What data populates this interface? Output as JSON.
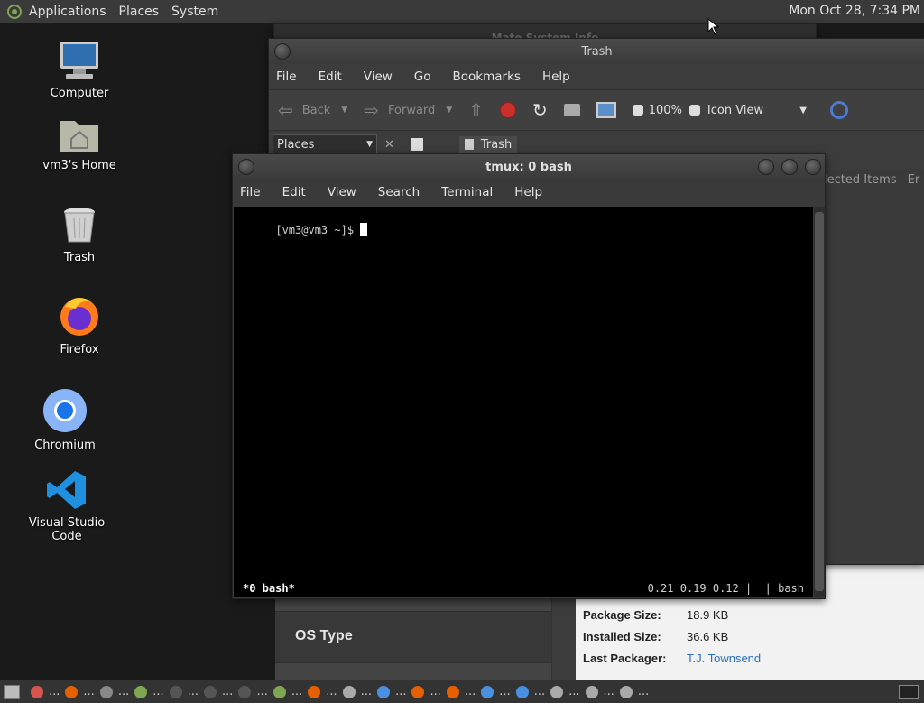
{
  "top_panel": {
    "menus": [
      "Applications",
      "Places",
      "System"
    ],
    "clock": "Mon Oct 28,  7:34 PM"
  },
  "desktop": {
    "icons": [
      {
        "label": "Computer",
        "icon": "computer-icon"
      },
      {
        "label": "vm3's Home",
        "icon": "home-folder-icon"
      },
      {
        "label": "Trash",
        "icon": "trash-icon"
      },
      {
        "label": "Firefox",
        "icon": "firefox-icon"
      },
      {
        "label": "Chromium",
        "icon": "chromium-icon"
      },
      {
        "label": "Visual Studio Code",
        "icon": "vscode-icon"
      }
    ]
  },
  "sysinfo_window": {
    "title": "Mate System Info",
    "os_type_label": "OS Type",
    "details": [
      {
        "key": "Package Size:",
        "value": "18.9 KB"
      },
      {
        "key": "Installed Size:",
        "value": "36.6 KB"
      },
      {
        "key": "Last Packager:",
        "value": "T.J. Townsend"
      }
    ]
  },
  "trash_window": {
    "title": "Trash",
    "menus": [
      "File",
      "Edit",
      "View",
      "Go",
      "Bookmarks",
      "Help"
    ],
    "toolbar": {
      "back": "Back",
      "forward": "Forward",
      "zoom": "100%",
      "view_mode": "Icon View"
    },
    "places_label": "Places",
    "location": "Trash",
    "columns_partial": "elected Items",
    "columns_partial2": "Er"
  },
  "terminal_window": {
    "title": "tmux: 0 bash",
    "menus": [
      "File",
      "Edit",
      "View",
      "Search",
      "Terminal",
      "Help"
    ],
    "prompt": "[vm3@vm3 ~]$ ",
    "status_left": "*0 bash*",
    "status_right": "0.21 0.19 0.12 |  | bash"
  },
  "taskbar": {
    "items": [
      {
        "icon": "help-icon",
        "color": "#d9534f",
        "label": "..."
      },
      {
        "icon": "firefox-icon",
        "color": "#e66000",
        "label": "..."
      },
      {
        "icon": "keyboard-icon",
        "color": "#888",
        "label": "..."
      },
      {
        "icon": "mate-icon",
        "color": "#7fa650",
        "label": "..."
      },
      {
        "icon": "app-icon",
        "color": "#555",
        "label": "..."
      },
      {
        "icon": "app-icon",
        "color": "#555",
        "label": "..."
      },
      {
        "icon": "app-icon",
        "color": "#555",
        "label": "..."
      },
      {
        "icon": "mate-icon",
        "color": "#7fa650",
        "label": "..."
      },
      {
        "icon": "firefox-icon",
        "color": "#e66000",
        "label": "..."
      },
      {
        "icon": "trash-icon",
        "color": "#aaa",
        "label": "..."
      },
      {
        "icon": "chromium-icon",
        "color": "#4a90e2",
        "label": "..."
      },
      {
        "icon": "firefox-icon",
        "color": "#e66000",
        "label": "..."
      },
      {
        "icon": "firefox-icon",
        "color": "#e66000",
        "label": "..."
      },
      {
        "icon": "chromium-icon",
        "color": "#4a90e2",
        "label": "..."
      },
      {
        "icon": "chromium-icon",
        "color": "#4a90e2",
        "label": "..."
      },
      {
        "icon": "computer-icon",
        "color": "#aaa",
        "label": "..."
      },
      {
        "icon": "computer-icon",
        "color": "#aaa",
        "label": "..."
      },
      {
        "icon": "terminal-icon",
        "color": "#aaa",
        "label": "..."
      }
    ]
  }
}
